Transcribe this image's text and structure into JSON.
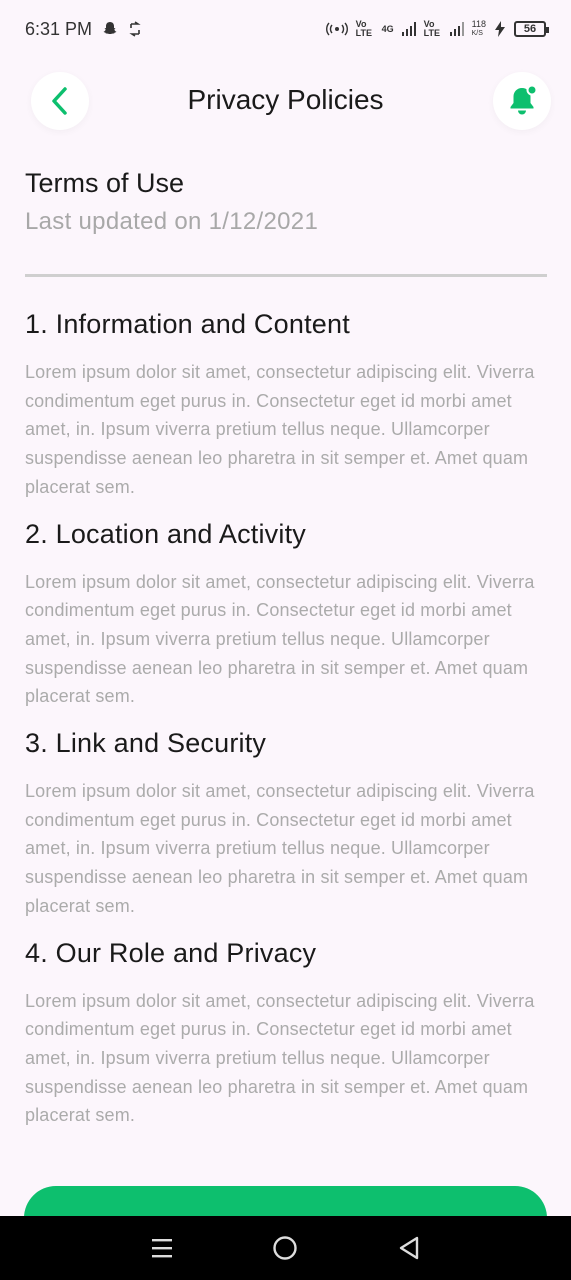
{
  "status_bar": {
    "time": "6:31 PM",
    "battery": "56",
    "network_speed": "118",
    "network_speed_unit": "K/S",
    "sim1": "Vo LTE",
    "sim2": "Vo LTE",
    "net_type": "4G"
  },
  "header": {
    "title": "Privacy Policies",
    "back_icon": "chevron-left-icon",
    "notification_icon": "bell-icon"
  },
  "document": {
    "title": "Terms of Use",
    "last_updated": "Last updated on 1/12/2021"
  },
  "sections": [
    {
      "heading": "1. Information and Content",
      "body": "Lorem ipsum dolor sit amet, consectetur adipiscing elit. Viverra condimentum eget purus in. Consectetur eget id morbi amet amet, in. Ipsum viverra pretium tellus neque. Ullamcorper suspendisse aenean leo pharetra in sit semper et. Amet quam placerat sem."
    },
    {
      "heading": "2. Location and Activity",
      "body": "Lorem ipsum dolor sit amet, consectetur adipiscing elit. Viverra condimentum eget purus in. Consectetur eget id morbi amet amet, in. Ipsum viverra pretium tellus neque. Ullamcorper suspendisse aenean leo pharetra in sit semper et. Amet quam placerat sem."
    },
    {
      "heading": "3. Link and Security",
      "body": "Lorem ipsum dolor sit amet, consectetur adipiscing elit. Viverra condimentum eget purus in. Consectetur eget id morbi amet amet, in. Ipsum viverra pretium tellus neque. Ullamcorper suspendisse aenean leo pharetra in sit semper et. Amet quam placerat sem."
    },
    {
      "heading": "4. Our Role and Privacy",
      "body": "Lorem ipsum dolor sit amet, consectetur adipiscing elit. Viverra condimentum eget purus in. Consectetur eget id morbi amet amet, in. Ipsum viverra pretium tellus neque. Ullamcorper suspendisse aenean leo pharetra in sit semper et. Amet quam placerat sem."
    }
  ],
  "colors": {
    "accent": "#0DBF6E",
    "background": "#FCF6FC",
    "body_text": "#ABABAB",
    "heading_text": "#1A1A1A"
  },
  "nav_bar": {
    "menu_icon": "menu-icon",
    "home_icon": "home-circle-icon",
    "back_icon": "triangle-back-icon"
  }
}
